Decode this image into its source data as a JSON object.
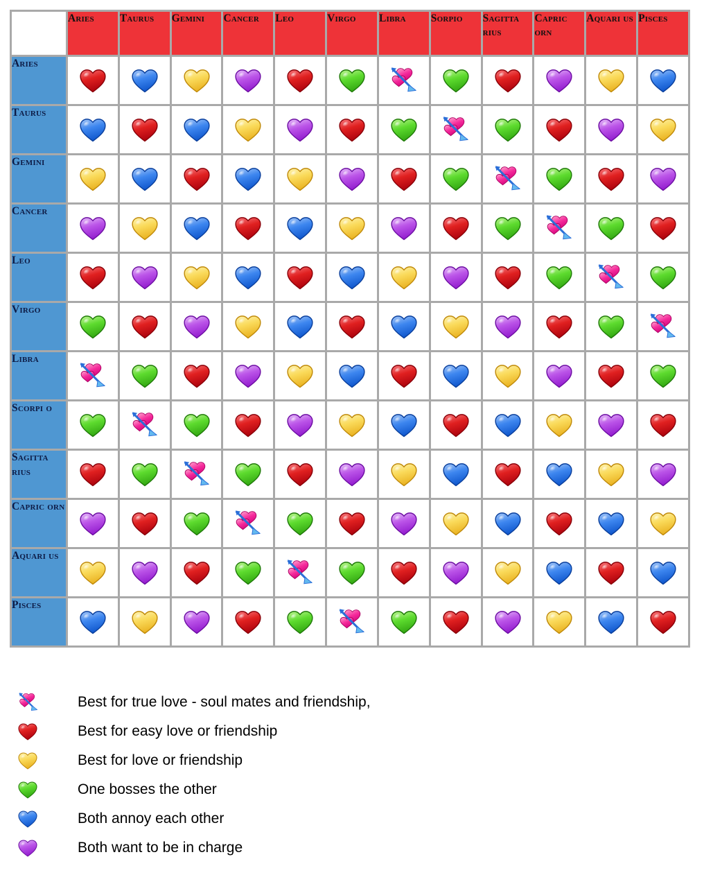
{
  "table": {
    "corner_label": "",
    "column_headers": [
      "Aries",
      "Taurus",
      "Gemini",
      "Cancer",
      "Leo",
      "Virgo",
      "Libra",
      "Sorpio",
      "Sagitta rius",
      "Capric orn",
      "Aquari us",
      "Pisces"
    ],
    "row_headers": [
      "Aries",
      "Taurus",
      "Gemini",
      "Cancer",
      "Leo",
      "Virgo",
      "Libra",
      "Scorpi o",
      "Sagitta rius",
      "Capric orn",
      "Aquari us",
      "Pisces"
    ],
    "header_bg_color": "#ee3338",
    "row_header_bg_color": "#4f97d2",
    "grid_color": "#a9a9a9",
    "cell_bg_color": "#ffffff",
    "rows": [
      {
        "sign": "Aries",
        "cells": [
          "red",
          "blue",
          "yellow",
          "purple",
          "red",
          "green",
          "arrow",
          "green",
          "red",
          "purple",
          "yellow",
          "blue"
        ]
      },
      {
        "sign": "Taurus",
        "cells": [
          "blue",
          "red",
          "blue",
          "yellow",
          "purple",
          "red",
          "green",
          "arrow",
          "green",
          "red",
          "purple",
          "yellow"
        ]
      },
      {
        "sign": "Gemini",
        "cells": [
          "yellow",
          "blue",
          "red",
          "blue",
          "yellow",
          "purple",
          "red",
          "green",
          "arrow",
          "green",
          "red",
          "purple"
        ]
      },
      {
        "sign": "Cancer",
        "cells": [
          "purple",
          "yellow",
          "blue",
          "red",
          "blue",
          "yellow",
          "purple",
          "red",
          "green",
          "arrow",
          "green",
          "red"
        ]
      },
      {
        "sign": "Leo",
        "cells": [
          "red",
          "purple",
          "yellow",
          "blue",
          "red",
          "blue",
          "yellow",
          "purple",
          "red",
          "green",
          "arrow",
          "green"
        ]
      },
      {
        "sign": "Virgo",
        "cells": [
          "green",
          "red",
          "purple",
          "yellow",
          "blue",
          "red",
          "blue",
          "yellow",
          "purple",
          "red",
          "green",
          "arrow"
        ]
      },
      {
        "sign": "Libra",
        "cells": [
          "arrow",
          "green",
          "red",
          "purple",
          "yellow",
          "blue",
          "red",
          "blue",
          "yellow",
          "purple",
          "red",
          "green"
        ]
      },
      {
        "sign": "Scorpio",
        "cells": [
          "green",
          "arrow",
          "green",
          "red",
          "purple",
          "yellow",
          "blue",
          "red",
          "blue",
          "yellow",
          "purple",
          "red"
        ]
      },
      {
        "sign": "Sagittarius",
        "cells": [
          "red",
          "green",
          "arrow",
          "green",
          "red",
          "purple",
          "yellow",
          "blue",
          "red",
          "blue",
          "yellow",
          "purple"
        ]
      },
      {
        "sign": "Capricorn",
        "cells": [
          "purple",
          "red",
          "green",
          "arrow",
          "green",
          "red",
          "purple",
          "yellow",
          "blue",
          "red",
          "blue",
          "yellow"
        ]
      },
      {
        "sign": "Aquarius",
        "cells": [
          "yellow",
          "purple",
          "red",
          "green",
          "arrow",
          "green",
          "red",
          "purple",
          "yellow",
          "blue",
          "red",
          "blue"
        ]
      },
      {
        "sign": "Pisces",
        "cells": [
          "blue",
          "yellow",
          "purple",
          "red",
          "green",
          "arrow",
          "green",
          "red",
          "purple",
          "yellow",
          "blue",
          "red"
        ]
      }
    ]
  },
  "legend": {
    "items": [
      {
        "icon": "arrow",
        "label": "Best for true love - soul mates and friendship,"
      },
      {
        "icon": "red",
        "label": "Best for easy love or friendship"
      },
      {
        "icon": "yellow",
        "label": "Best for love or friendship"
      },
      {
        "icon": "green",
        "label": "One bosses the other"
      },
      {
        "icon": "blue",
        "label": "Both annoy each other"
      },
      {
        "icon": "purple",
        "label": "Both want to be in charge"
      }
    ]
  },
  "heart_colors": {
    "red": {
      "light": "#f2666a",
      "mid": "#e02020",
      "dark": "#a8000c",
      "edge": "#8a0008"
    },
    "yellow": {
      "light": "#fdeea0",
      "mid": "#fada5a",
      "dark": "#e8ae1c",
      "edge": "#c08a0a"
    },
    "green": {
      "light": "#a9ef7e",
      "mid": "#5ddb2e",
      "dark": "#2fa310",
      "edge": "#1f7a08"
    },
    "blue": {
      "light": "#8fb9f5",
      "mid": "#3d86ef",
      "dark": "#0b52c9",
      "edge": "#0a3f9c"
    },
    "purple": {
      "light": "#dca6f5",
      "mid": "#bb54e8",
      "dark": "#8f17cc",
      "edge": "#6d0ea3"
    },
    "arrow": {
      "light": "#ff8ec6",
      "mid": "#f52a9b",
      "dark": "#d1007a",
      "edge": "#a80060",
      "arrow_shaft": "#2b6fd8",
      "arrow_head": "#63b9ef"
    }
  }
}
